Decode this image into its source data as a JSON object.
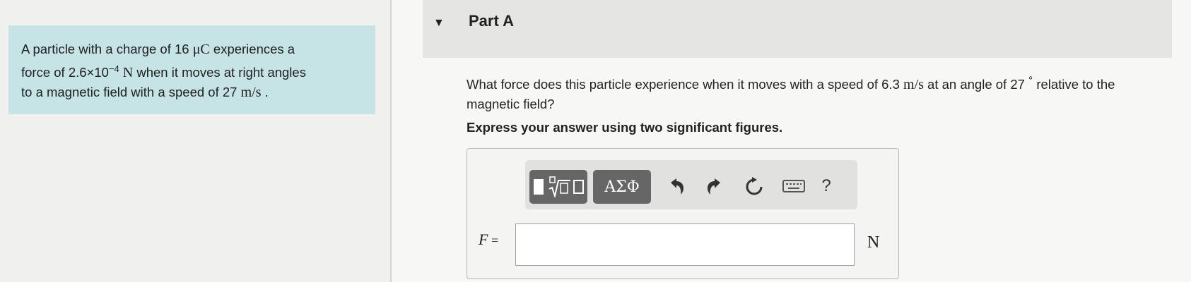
{
  "problem": {
    "line1_pre": "A particle with a charge of 16 ",
    "line1_unit": "μC",
    "line1_post": " experiences a",
    "line2_pre": "force of 2.6×10",
    "line2_exp": "−4",
    "line2_unit": " N",
    "line2_post": " when it moves at right angles",
    "line3_pre": "to a magnetic field with a speed of 27 ",
    "line3_unit": "m/s",
    "line3_post": " ."
  },
  "part": {
    "caret": "▼",
    "title": "Part A"
  },
  "question": {
    "text_pre": "What force does this particle experience when it moves with a speed of 6.3 ",
    "speed_unit": "m/s",
    "text_mid": " at an angle of 27 ",
    "degree": "°",
    "text_post": " relative to the magnetic field?"
  },
  "instruction": "Express your answer using two significant figures.",
  "toolbar": {
    "greek_label": "ΑΣΦ",
    "undo_icon": "undo-icon",
    "redo_icon": "redo-icon",
    "reset_icon": "reset-icon",
    "keyboard_icon": "keyboard-icon",
    "help_label": "?"
  },
  "answer": {
    "variable": "F",
    "equals": " =",
    "value": "",
    "unit": "N"
  }
}
